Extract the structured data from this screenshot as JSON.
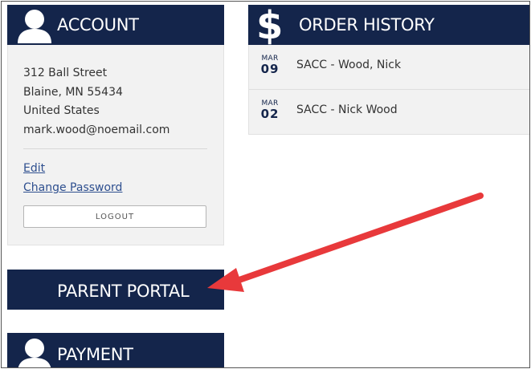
{
  "account": {
    "title": "ACCOUNT",
    "address": [
      "312 Ball Street",
      "Blaine, MN 55434",
      "United States",
      "mark.wood@noemail.com"
    ],
    "edit_link": "Edit",
    "change_password_link": "Change Password",
    "logout_button": "LOGOUT"
  },
  "parent_portal": {
    "title": "PARENT PORTAL"
  },
  "payment": {
    "title": "PAYMENT"
  },
  "order_history": {
    "title": "ORDER HISTORY",
    "orders": [
      {
        "month": "MAR",
        "day": "09",
        "name": "SACC - Wood, Nick"
      },
      {
        "month": "MAR",
        "day": "02",
        "name": "SACC - Nick Wood"
      }
    ]
  },
  "colors": {
    "header_bg": "#14254b",
    "panel_bg": "#f2f2f2",
    "link": "#2e4f8f",
    "annotation_arrow": "#e8393b"
  },
  "icons": {
    "account": "user-icon",
    "payment": "user-icon",
    "order_history": "dollar-icon"
  }
}
